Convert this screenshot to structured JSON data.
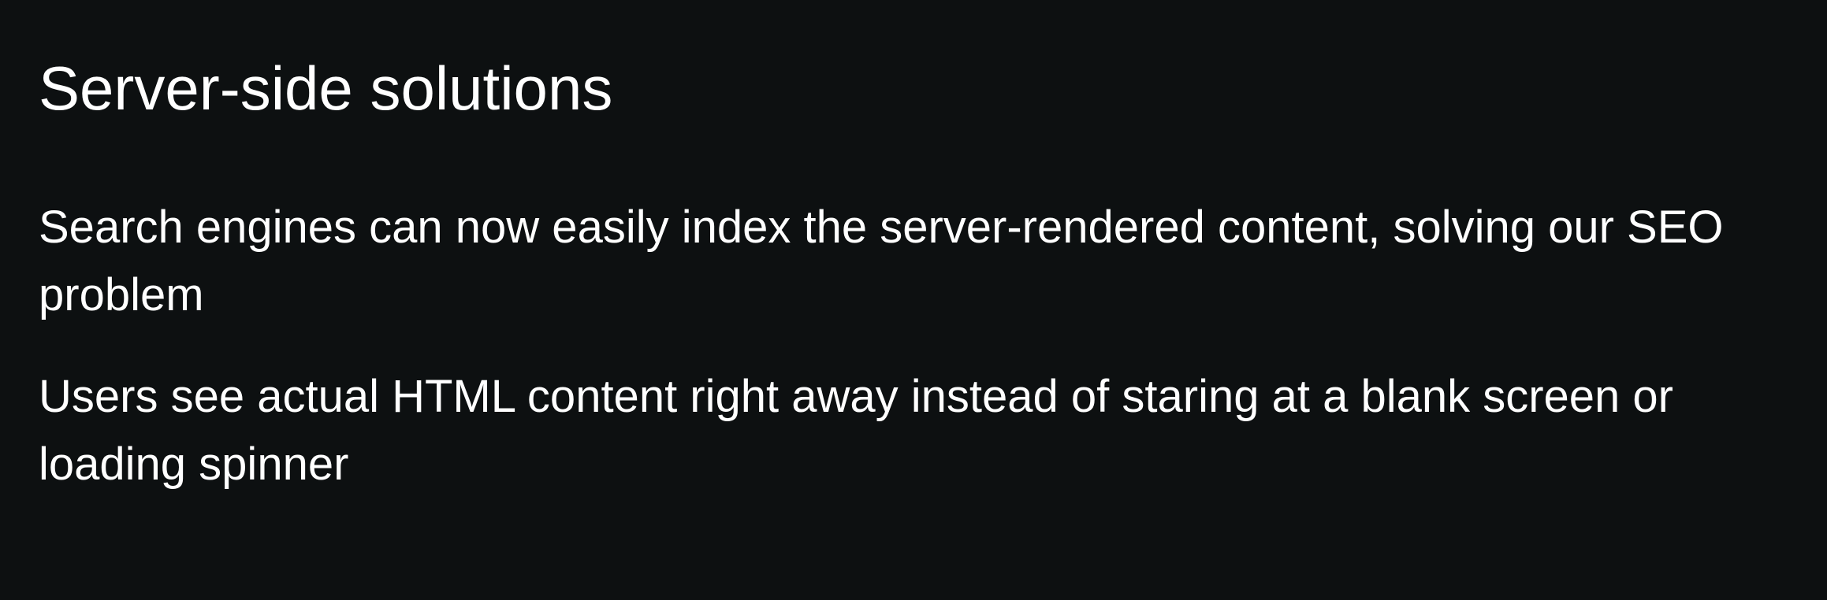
{
  "heading": "Server-side solutions",
  "points": [
    "Search engines can now easily index the server-rendered content, solving our SEO problem",
    "Users see actual HTML content right away instead of staring at a blank screen or loading spinner"
  ],
  "colors": {
    "background": "#0d1011",
    "text": "#ffffff"
  }
}
